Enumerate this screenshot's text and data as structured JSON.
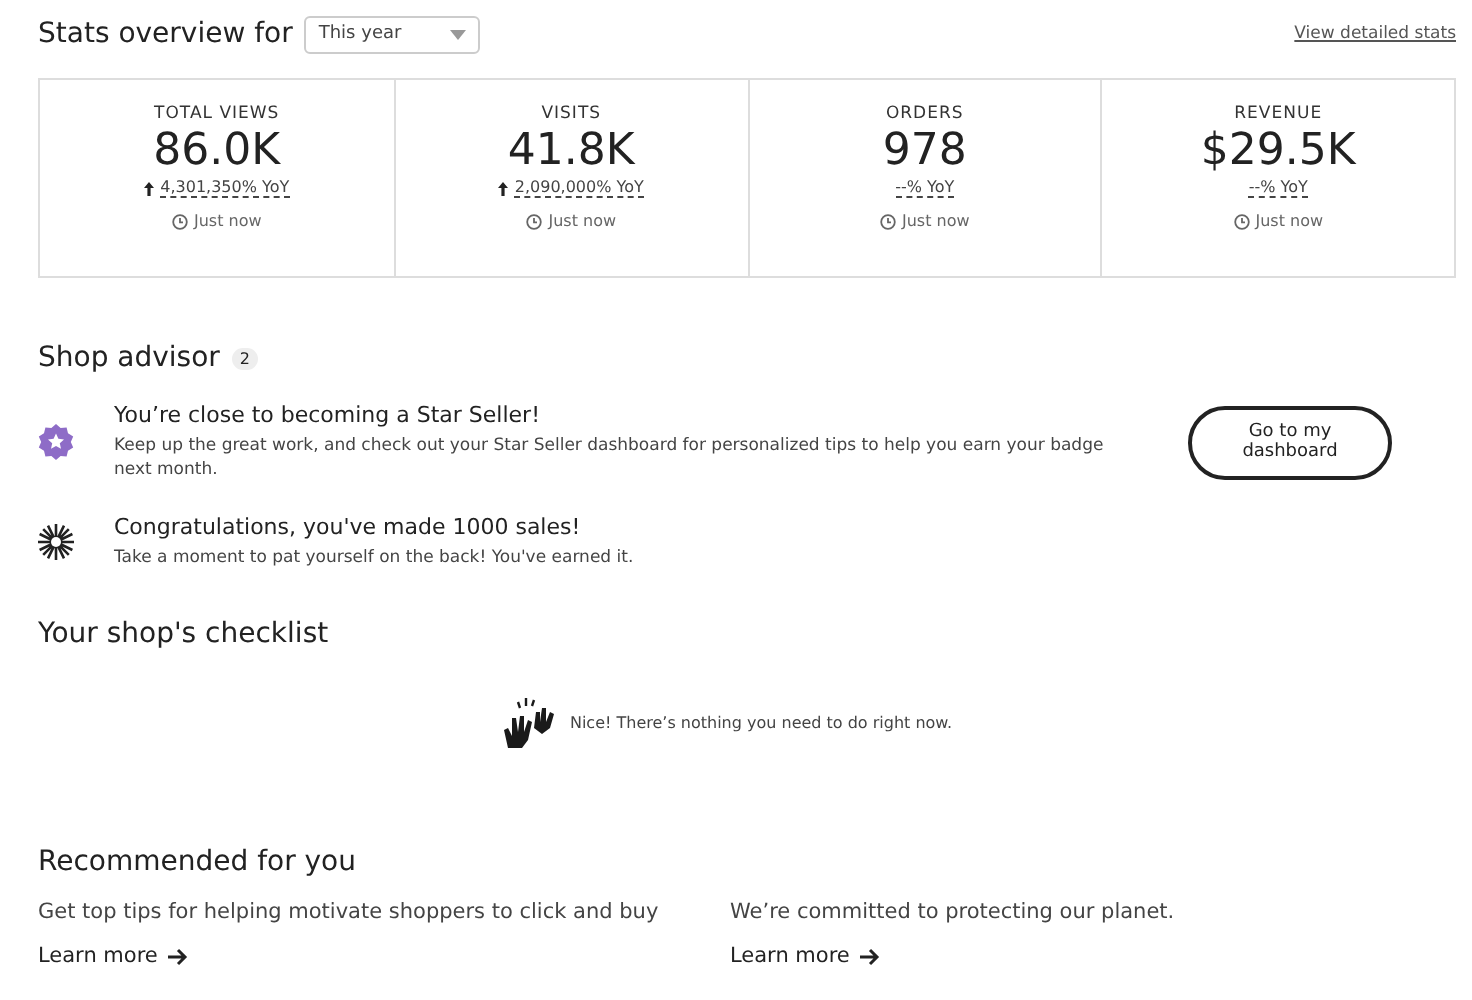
{
  "stats_header": {
    "title": "Stats overview for",
    "period": "This year",
    "link": "View detailed stats"
  },
  "stats": [
    {
      "label": "TOTAL VIEWS",
      "value": "86.0K",
      "trend_up": true,
      "change": "4,301,350% YoY",
      "updated": "Just now"
    },
    {
      "label": "VISITS",
      "value": "41.8K",
      "trend_up": true,
      "change": "2,090,000% YoY",
      "updated": "Just now"
    },
    {
      "label": "ORDERS",
      "value": "978",
      "trend_up": false,
      "change": "--% YoY",
      "updated": "Just now"
    },
    {
      "label": "REVENUE",
      "value": "$29.5K",
      "trend_up": false,
      "change": "--% YoY",
      "updated": "Just now"
    }
  ],
  "shop_advisor": {
    "title": "Shop advisor",
    "count": "2",
    "items": [
      {
        "kind": "star",
        "title": "You’re close to becoming a Star Seller!",
        "text": "Keep up the great work, and check out your Star Seller dashboard for personalized tips to help you earn your badge next month.",
        "button": "Go to my dashboard"
      },
      {
        "kind": "burst",
        "title": "Congratulations, you've made 1000 sales!",
        "text": "Take a moment to pat yourself on the back! You've earned it."
      }
    ]
  },
  "checklist": {
    "title": "Your shop's checklist",
    "message": "Nice! There’s nothing you need to do right now."
  },
  "recommended": {
    "title": "Recommended for you",
    "items": [
      {
        "text": "Get top tips for helping motivate shoppers to click and buy",
        "link": "Learn more"
      },
      {
        "text": "We’re committed to protecting our planet.",
        "link": "Learn more"
      }
    ]
  }
}
